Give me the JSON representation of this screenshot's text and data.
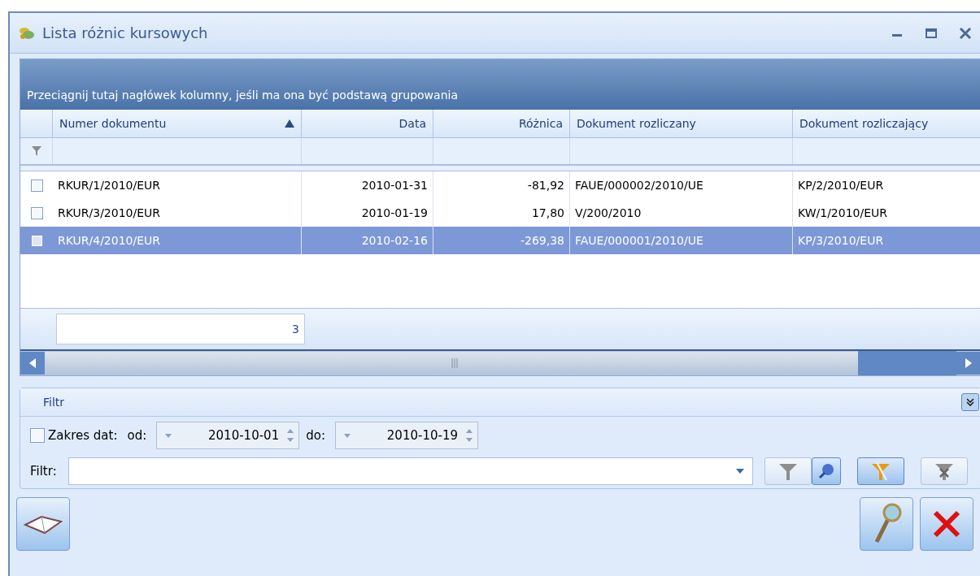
{
  "window": {
    "title": "Lista różnic kursowych"
  },
  "grid": {
    "group_panel_hint": "Przeciągnij tutaj nagłówek kolumny, jeśli ma ona być podstawą grupowania",
    "columns": [
      {
        "label": "Numer dokumentu",
        "sorted": true
      },
      {
        "label": "Data",
        "sorted": false
      },
      {
        "label": "Różnica",
        "sorted": false
      },
      {
        "label": "Dokument rozliczany",
        "sorted": false
      },
      {
        "label": "Dokument rozliczający",
        "sorted": false
      }
    ],
    "rows": [
      {
        "selected": false,
        "checked": false,
        "cells": [
          "RKUR/1/2010/EUR",
          "2010-01-31",
          "-81,92",
          "FAUE/000002/2010/UE",
          "KP/2/2010/EUR"
        ]
      },
      {
        "selected": false,
        "checked": false,
        "cells": [
          "RKUR/3/2010/EUR",
          "2010-01-19",
          "17,80",
          "V/200/2010",
          "KW/1/2010/EUR"
        ]
      },
      {
        "selected": true,
        "checked": false,
        "cells": [
          "RKUR/4/2010/EUR",
          "2010-02-16",
          "-269,38",
          "FAUE/000001/2010/UE",
          "KP/3/2010/EUR"
        ]
      }
    ],
    "footer": {
      "count": "3"
    }
  },
  "filter_panel": {
    "title": "Filtr",
    "date_range": {
      "label": "Zakres dat:",
      "checked": false,
      "from_label": "od:",
      "from": "2010-10-01",
      "to_label": "do:",
      "to": "2010-10-19"
    },
    "filter_label": "Filtr:"
  }
}
